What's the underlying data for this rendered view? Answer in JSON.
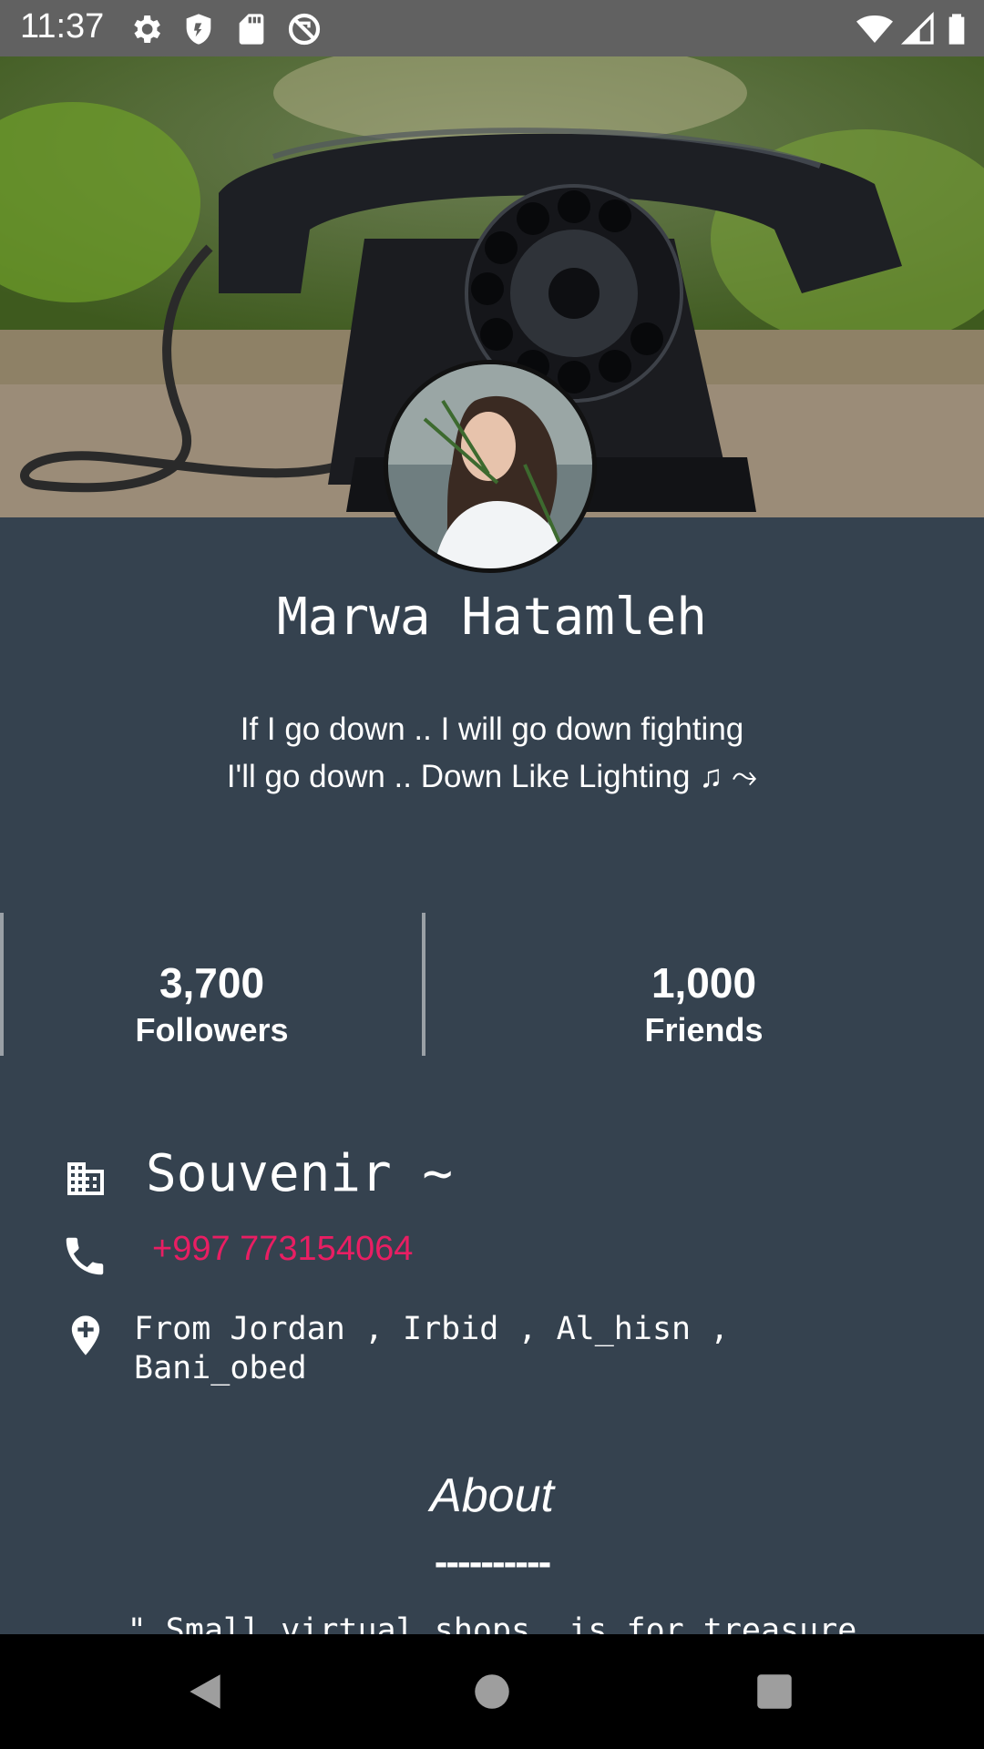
{
  "status_bar": {
    "time": "11:37",
    "left_icons": [
      "settings-icon",
      "shield-icon",
      "sd-card-icon",
      "sync-blocked-icon"
    ],
    "right_icons": [
      "wifi-icon",
      "signal-icon",
      "battery-icon"
    ]
  },
  "profile": {
    "name": "Marwa Hatamleh",
    "bio_line1": "If I go down .. I will go down fighting",
    "bio_line2": "I'll go down .. Down Like Lighting ♫ ⤳"
  },
  "stats": [
    {
      "value": "3,700",
      "label": "Followers"
    },
    {
      "value": "1,000",
      "label": "Friends"
    }
  ],
  "info": {
    "company": "Souvenir ~",
    "phone": "+997 773154064",
    "address": "From Jordan , Irbid , Al_hisn , Bani_obed"
  },
  "about": {
    "title": "About",
    "separator": "----------",
    "text": "\" Small virtual shops, is for treasure"
  },
  "colors": {
    "background": "#35424f",
    "accent": "#e91e63",
    "status_bar": "#616161"
  },
  "nav": [
    "back-icon",
    "home-icon",
    "recents-icon"
  ]
}
